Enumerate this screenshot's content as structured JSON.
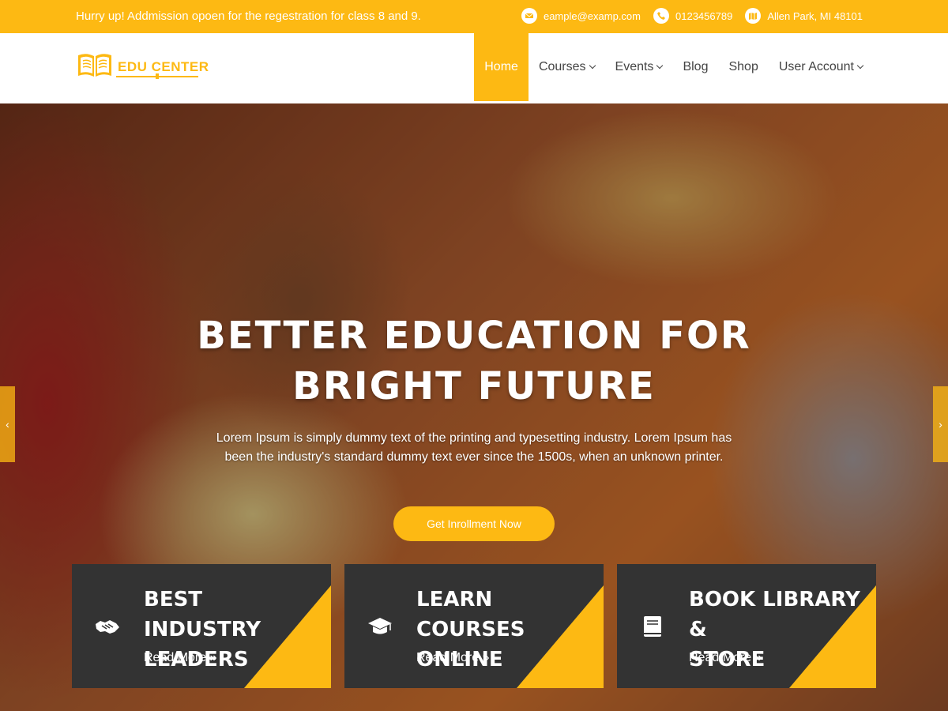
{
  "topbar": {
    "notice": "Hurry up! Addmission opoen for the regestration for class 8 and 9.",
    "email": "eample@examp.com",
    "phone": "0123456789",
    "address": "Allen Park, MI 48101"
  },
  "header": {
    "logo_text": "EDU CENTER"
  },
  "nav": {
    "items": [
      {
        "label": "Home",
        "active": true
      },
      {
        "label": "Courses"
      },
      {
        "label": "Events"
      },
      {
        "label": "Blog"
      },
      {
        "label": "Shop"
      },
      {
        "label": "User Account"
      }
    ]
  },
  "hero": {
    "title_line1": "BETTER EDUCATION FOR",
    "title_line2": "BRIGHT FUTURE",
    "text": "Lorem Ipsum is simply dummy text of the printing and typesetting industry. Lorem Ipsum has been the industry's standard dummy text ever since the 1500s, when an unknown printer.",
    "button_label": "Get Inrollment Now"
  },
  "slider": {
    "prev": "‹",
    "next": "›"
  },
  "cards": [
    {
      "title_line1": "BEST INDUSTRY",
      "title_line2": "LEADERS",
      "read_more": "Read More",
      "icon": "handshake-icon"
    },
    {
      "title_line1": "LEARN COURSES",
      "title_line2": "ONLINE",
      "read_more": "Read More",
      "icon": "graduation-cap-icon"
    },
    {
      "title_line1": "BOOK LIBRARY &",
      "title_line2": "STORE",
      "read_more": "Read More",
      "icon": "book-icon"
    }
  ],
  "colors": {
    "accent": "#fdb913",
    "card_bg": "#333333"
  }
}
